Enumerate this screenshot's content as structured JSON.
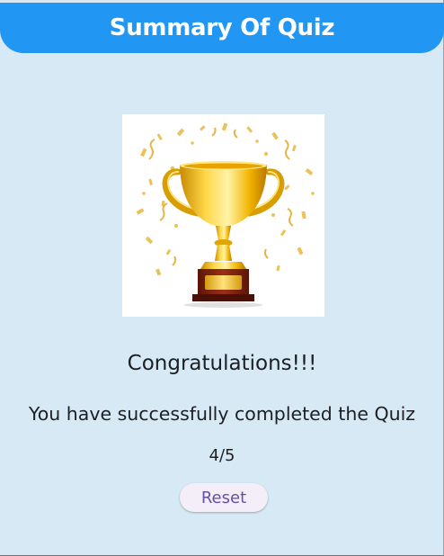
{
  "app_bar": {
    "title": "Summary Of Quiz",
    "color": "#2196f3"
  },
  "result": {
    "image": "trophy-with-confetti",
    "congrats": "Congratulations!!!",
    "message": "You have successfully completed the Quiz",
    "score": "4/5"
  },
  "actions": {
    "reset_label": "Reset",
    "reset_text_color": "#6750a4"
  },
  "colors": {
    "background": "#d6e9f5",
    "trophy_gold": "#f0b400",
    "trophy_base": "#7a1f12"
  }
}
